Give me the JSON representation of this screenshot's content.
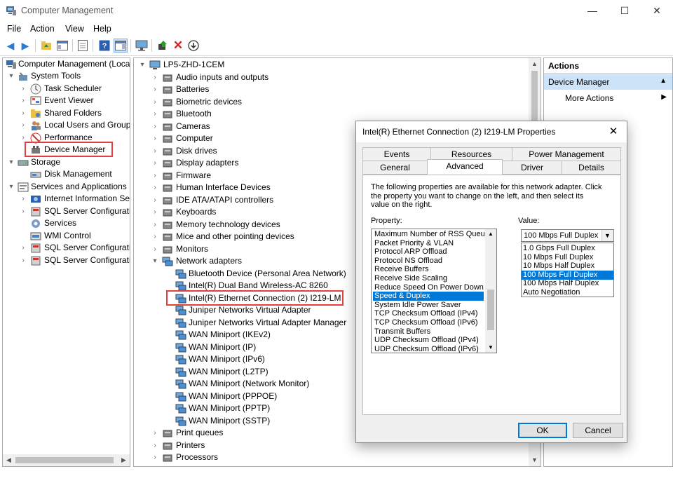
{
  "window": {
    "title": "Computer Management",
    "minimize": "—",
    "maximize": "☐",
    "close": "✕"
  },
  "menu": [
    "File",
    "Action",
    "View",
    "Help"
  ],
  "left_tree": {
    "root": "Computer Management (Local",
    "system_tools": "System Tools",
    "task_scheduler": "Task Scheduler",
    "event_viewer": "Event Viewer",
    "shared_folders": "Shared Folders",
    "local_users": "Local Users and Groups",
    "performance": "Performance",
    "device_manager": "Device Manager",
    "storage": "Storage",
    "disk_management": "Disk Management",
    "services_apps": "Services and Applications",
    "iis": "Internet Information Ser",
    "sql1": "SQL Server Configuratic",
    "services": "Services",
    "wmi": "WMI Control",
    "sql2": "SQL Server Configuratic",
    "sql3": "SQL Server Configuratic"
  },
  "device_tree": {
    "computer": "LP5-ZHD-1CEM",
    "categories": [
      "Audio inputs and outputs",
      "Batteries",
      "Biometric devices",
      "Bluetooth",
      "Cameras",
      "Computer",
      "Disk drives",
      "Display adapters",
      "Firmware",
      "Human Interface Devices",
      "IDE ATA/ATAPI controllers",
      "Keyboards",
      "Memory technology devices",
      "Mice and other pointing devices",
      "Monitors",
      "Network adapters"
    ],
    "network_adapters": [
      "Bluetooth Device (Personal Area Network)",
      "Intel(R) Dual Band Wireless-AC 8260",
      "Intel(R) Ethernet Connection (2) I219-LM",
      "Juniper Networks Virtual Adapter",
      "Juniper Networks Virtual Adapter Manager",
      "WAN Miniport (IKEv2)",
      "WAN Miniport (IP)",
      "WAN Miniport (IPv6)",
      "WAN Miniport (L2TP)",
      "WAN Miniport (Network Monitor)",
      "WAN Miniport (PPPOE)",
      "WAN Miniport (PPTP)",
      "WAN Miniport (SSTP)"
    ],
    "after": [
      "Print queues",
      "Printers",
      "Processors"
    ]
  },
  "actions": {
    "header": "Actions",
    "section": "Device Manager",
    "more": "More Actions"
  },
  "dialog": {
    "title": "Intel(R) Ethernet Connection (2) I219-LM Properties",
    "tabs_row1": [
      "Events",
      "Resources",
      "Power Management"
    ],
    "tabs_row2": [
      "General",
      "Advanced",
      "Driver",
      "Details"
    ],
    "description": "The following properties are available for this network adapter. Click the property you want to change on the left, and then select its value on the right.",
    "property_label": "Property:",
    "value_label": "Value:",
    "properties": [
      "Maximum Number of RSS Queues",
      "Packet Priority & VLAN",
      "Protocol ARP Offload",
      "Protocol NS Offload",
      "Receive Buffers",
      "Receive Side Scaling",
      "Reduce Speed On Power Down",
      "Speed & Duplex",
      "System Idle Power Saver",
      "TCP Checksum Offload (IPv4)",
      "TCP Checksum Offload (IPv6)",
      "Transmit Buffers",
      "UDP Checksum Offload (IPv4)",
      "UDP Checksum Offload (IPv6)"
    ],
    "selected_property": "Speed & Duplex",
    "value_selected": "100 Mbps Full Duplex",
    "value_options": [
      "1.0 Gbps Full Duplex",
      "10 Mbps Full Duplex",
      "10 Mbps Half Duplex",
      "100 Mbps Full Duplex",
      "100 Mbps Half Duplex",
      "Auto Negotiation"
    ],
    "ok": "OK",
    "cancel": "Cancel"
  }
}
